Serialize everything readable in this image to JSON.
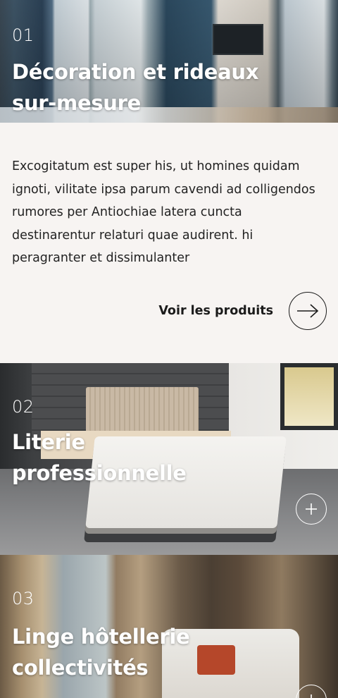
{
  "sections": [
    {
      "number": "01",
      "title_line1": "Décoration et rideaux",
      "title_line2": "sur-mesure"
    },
    {
      "number": "02",
      "title_line1": "Literie",
      "title_line2": "professionnelle",
      "icon": "plus-icon"
    },
    {
      "number": "03",
      "title_line1": "Linge hôtellerie",
      "title_line2": "collectivités",
      "icon": "plus-icon"
    }
  ],
  "description": "Excogitatum est super his, ut homines quidam ignoti, vilitate ipsa parum cavendi ad colligendos rumores per Antiochiae latera cuncta destinarentur relaturi quae audirent. hi peragranter et dissimulanter",
  "cta": {
    "label": "Voir les produits",
    "icon": "arrow-right-icon"
  },
  "colors": {
    "background": "#f7f4f2",
    "text": "#1b1b1b",
    "overlay_text": "#ffffff"
  }
}
